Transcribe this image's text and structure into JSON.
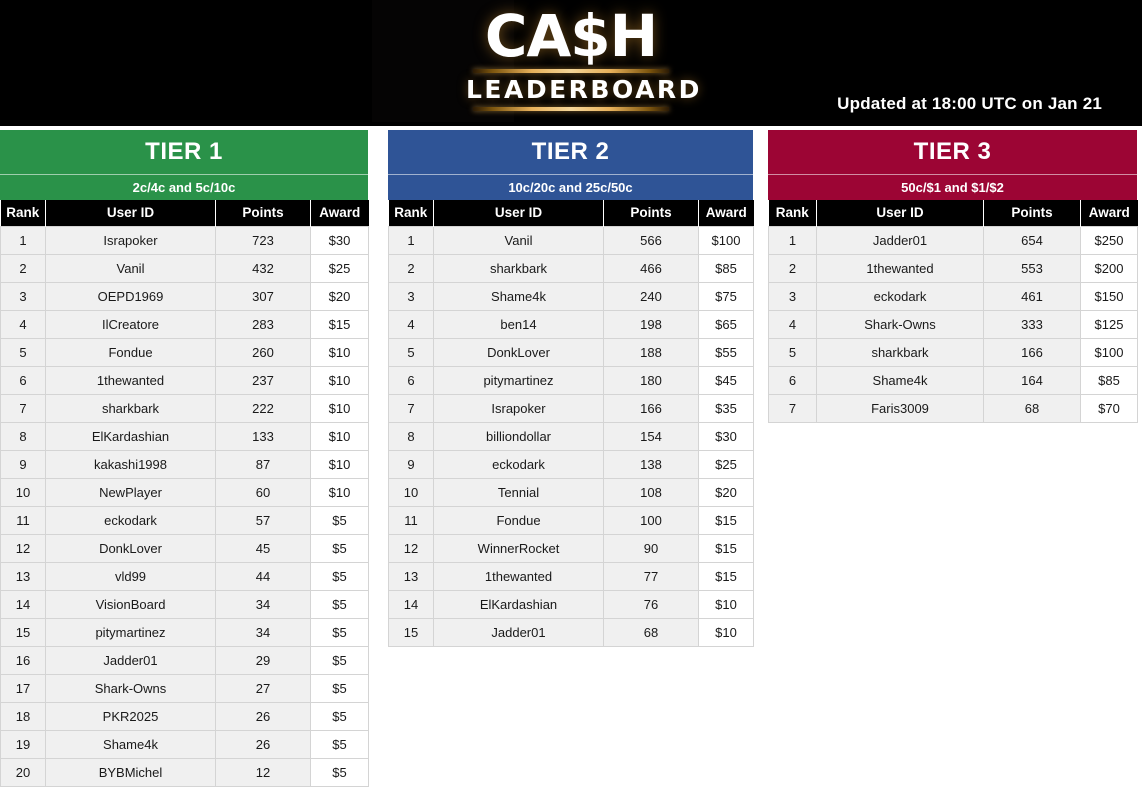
{
  "banner": {
    "logo_line1": "CA$H",
    "logo_line2": "LEADERBOARD",
    "updated": "Updated at 18:00 UTC on Jan 21"
  },
  "columns": [
    "Rank",
    "User ID",
    "Points",
    "Award"
  ],
  "tiers": [
    {
      "title": "TIER 1",
      "subtitle": "2c/4c and 5c/10c",
      "color": "#2a9249",
      "rows": [
        [
          "1",
          "Israpoker",
          "723",
          "$30"
        ],
        [
          "2",
          "Vanil",
          "432",
          "$25"
        ],
        [
          "3",
          "OEPD1969",
          "307",
          "$20"
        ],
        [
          "4",
          "IlCreatore",
          "283",
          "$15"
        ],
        [
          "5",
          "Fondue",
          "260",
          "$10"
        ],
        [
          "6",
          "1thewanted",
          "237",
          "$10"
        ],
        [
          "7",
          "sharkbark",
          "222",
          "$10"
        ],
        [
          "8",
          "ElKardashian",
          "133",
          "$10"
        ],
        [
          "9",
          "kakashi1998",
          "87",
          "$10"
        ],
        [
          "10",
          "NewPlayer",
          "60",
          "$10"
        ],
        [
          "11",
          "eckodark",
          "57",
          "$5"
        ],
        [
          "12",
          "DonkLover",
          "45",
          "$5"
        ],
        [
          "13",
          "vld99",
          "44",
          "$5"
        ],
        [
          "14",
          "VisionBoard",
          "34",
          "$5"
        ],
        [
          "15",
          "pitymartinez",
          "34",
          "$5"
        ],
        [
          "16",
          "Jadder01",
          "29",
          "$5"
        ],
        [
          "17",
          "Shark-Owns",
          "27",
          "$5"
        ],
        [
          "18",
          "PKR2025",
          "26",
          "$5"
        ],
        [
          "19",
          "Shame4k",
          "26",
          "$5"
        ],
        [
          "20",
          "BYBMichel",
          "12",
          "$5"
        ]
      ]
    },
    {
      "title": "TIER 2",
      "subtitle": "10c/20c and 25c/50c",
      "color": "#2f5496",
      "rows": [
        [
          "1",
          "Vanil",
          "566",
          "$100"
        ],
        [
          "2",
          "sharkbark",
          "466",
          "$85"
        ],
        [
          "3",
          "Shame4k",
          "240",
          "$75"
        ],
        [
          "4",
          "ben14",
          "198",
          "$65"
        ],
        [
          "5",
          "DonkLover",
          "188",
          "$55"
        ],
        [
          "6",
          "pitymartinez",
          "180",
          "$45"
        ],
        [
          "7",
          "Israpoker",
          "166",
          "$35"
        ],
        [
          "8",
          "billiondollar",
          "154",
          "$30"
        ],
        [
          "9",
          "eckodark",
          "138",
          "$25"
        ],
        [
          "10",
          "Tennial",
          "108",
          "$20"
        ],
        [
          "11",
          "Fondue",
          "100",
          "$15"
        ],
        [
          "12",
          "WinnerRocket",
          "90",
          "$15"
        ],
        [
          "13",
          "1thewanted",
          "77",
          "$15"
        ],
        [
          "14",
          "ElKardashian",
          "76",
          "$10"
        ],
        [
          "15",
          "Jadder01",
          "68",
          "$10"
        ]
      ]
    },
    {
      "title": "TIER 3",
      "subtitle": "50c/$1 and $1/$2",
      "color": "#9c0534",
      "rows": [
        [
          "1",
          "Jadder01",
          "654",
          "$250"
        ],
        [
          "2",
          "1thewanted",
          "553",
          "$200"
        ],
        [
          "3",
          "eckodark",
          "461",
          "$150"
        ],
        [
          "4",
          "Shark-Owns",
          "333",
          "$125"
        ],
        [
          "5",
          "sharkbark",
          "166",
          "$100"
        ],
        [
          "6",
          "Shame4k",
          "164",
          "$85"
        ],
        [
          "7",
          "Faris3009",
          "68",
          "$70"
        ]
      ]
    }
  ]
}
